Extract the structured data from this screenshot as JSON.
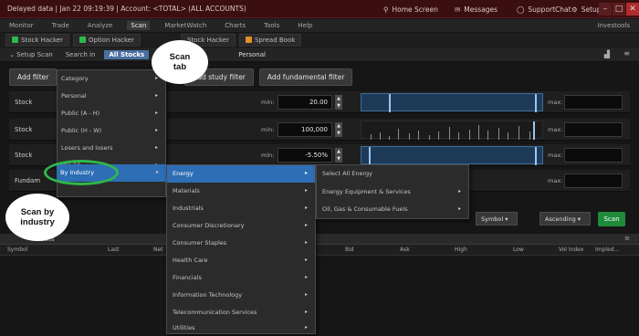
{
  "titlebar": {
    "account_info": "Delayed data  |  Jan 22  09:19:39  |  Account: <TOTAL> (ALL ACCOUNTS)",
    "right_items": [
      "Home Screen",
      "Messages",
      "SupportChat",
      "Setup"
    ]
  },
  "menu": {
    "items": [
      "Monitor",
      "Trade",
      "Analyze",
      "Scan",
      "MarketWatch",
      "Charts",
      "Tools",
      "Help"
    ],
    "active": "Scan",
    "right": "Investools"
  },
  "subtabs": {
    "items": [
      {
        "label": "Stock Hacker",
        "color": "#2fb84b"
      },
      {
        "label": "Option Hacker",
        "color": "#2fb84b"
      },
      {
        "label": "Stock Hacker",
        "color": "#7a7a7a"
      },
      {
        "label": "Spread Book",
        "color": "#e0902a"
      }
    ]
  },
  "setup": {
    "label": "Setup Scan",
    "search_in": "Search in",
    "dropdown": "All Stocks",
    "dropdown2": "Personal"
  },
  "filters": {
    "add_filter": "Add filter",
    "add_study": "Add study filter",
    "add_fundamental": "Add fundamental filter",
    "rows": [
      {
        "label": "Stock",
        "min_label": "min:",
        "min_value": "20.00",
        "max_label": "max:"
      },
      {
        "label": "Stock",
        "min_label": "min:",
        "min_value": "100,000",
        "max_label": "max:"
      },
      {
        "label": "Stock",
        "min_label": "min:",
        "min_value": "-5.50%",
        "max_label": "max:"
      },
      {
        "label": "Fundam",
        "min_label": "",
        "min_value": "",
        "max_label": "max:"
      }
    ]
  },
  "category_menu": {
    "items": [
      {
        "label": "Category",
        "arrow": "▸"
      },
      {
        "label": "Personal",
        "arrow": "▸"
      },
      {
        "label": "Public (A - H)",
        "arrow": "▸"
      },
      {
        "label": "Public (H - W)",
        "arrow": "▸"
      },
      {
        "label": "Losers and losers",
        "arrow": "▸"
      },
      {
        "label": "Top 10",
        "arrow": "▸"
      },
      {
        "label": "By Industry",
        "arrow": "▸"
      }
    ],
    "selected_index": 6
  },
  "sector_menu": {
    "items": [
      "Energy",
      "Materials",
      "Industrials",
      "Consumer Discretionary",
      "Consumer Staples",
      "Health Care",
      "Financials",
      "Information Technology",
      "Telecommunication Services",
      "Utilities"
    ],
    "selected_index": 0
  },
  "energy_menu": {
    "items": [
      "Select All Energy",
      "Energy Equipment & Services",
      "Oil, Gas & Consumable Fuels"
    ]
  },
  "sort": {
    "field": "Symbol",
    "order": "Ascending",
    "scan_label": "Scan"
  },
  "results": {
    "title": "Results",
    "columns": [
      "Symbol",
      "Last",
      "Net",
      "Bid",
      "Ask",
      "High",
      "Low",
      "Vol Index",
      "Impled..."
    ]
  },
  "callouts": {
    "scan_tab": "Scan tab",
    "scan_by_industry": "Scan by industry"
  },
  "colors": {
    "titlebar": "#3b0f10",
    "selection": "#2e6eb4",
    "ring": "#2fb84b",
    "scan_button": "#1f8a3a"
  }
}
